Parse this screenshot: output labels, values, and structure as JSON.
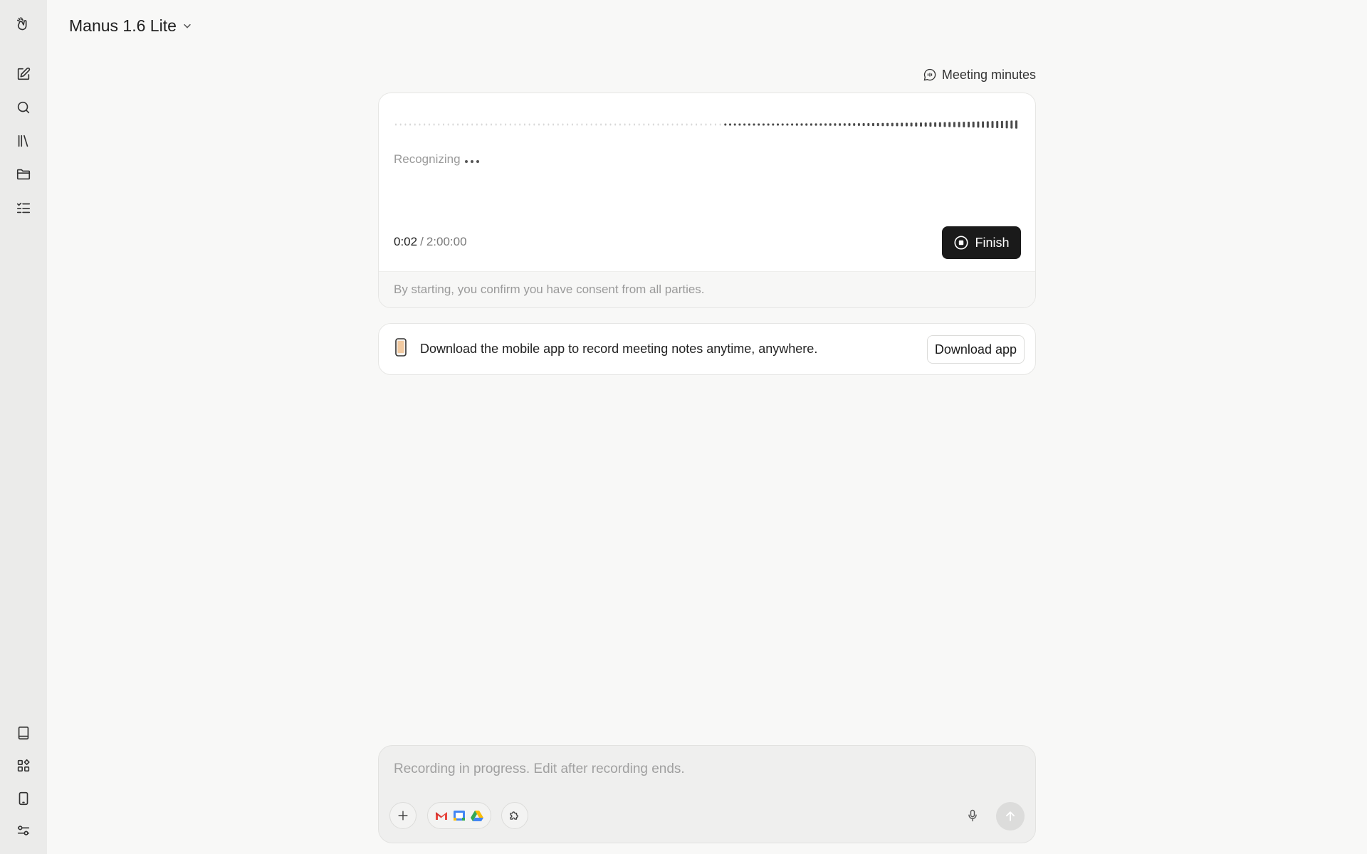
{
  "header": {
    "model_name": "Manus 1.6 Lite"
  },
  "sidebar": {
    "top_items": [
      {
        "icon": "logo-hand-icon"
      },
      {
        "icon": "new-task-icon"
      },
      {
        "icon": "search-icon"
      },
      {
        "icon": "library-icon"
      },
      {
        "icon": "folder-icon"
      },
      {
        "icon": "tasks-checklist-icon"
      }
    ],
    "bottom_items": [
      {
        "icon": "book-icon"
      },
      {
        "icon": "apps-grid-icon"
      },
      {
        "icon": "mobile-device-icon"
      },
      {
        "icon": "settings-sliders-icon"
      }
    ]
  },
  "meeting": {
    "link_label": "Meeting minutes",
    "recognizing_label": "Recognizing",
    "elapsed": "0:02",
    "separator": "/",
    "total": "2:00:00",
    "finish_label": "Finish",
    "consent_text": "By starting, you confirm you have consent from all parties."
  },
  "banner": {
    "text": "Download the mobile app to record meeting notes anytime, anywhere.",
    "button_label": "Download app"
  },
  "composer": {
    "placeholder": "Recording in progress. Edit after recording ends."
  },
  "colors": {
    "background": "#f8f8f7",
    "sidebar": "#ebebea",
    "finish_button": "#1a1a1a",
    "send_button_disabled": "#dcdcdb"
  }
}
